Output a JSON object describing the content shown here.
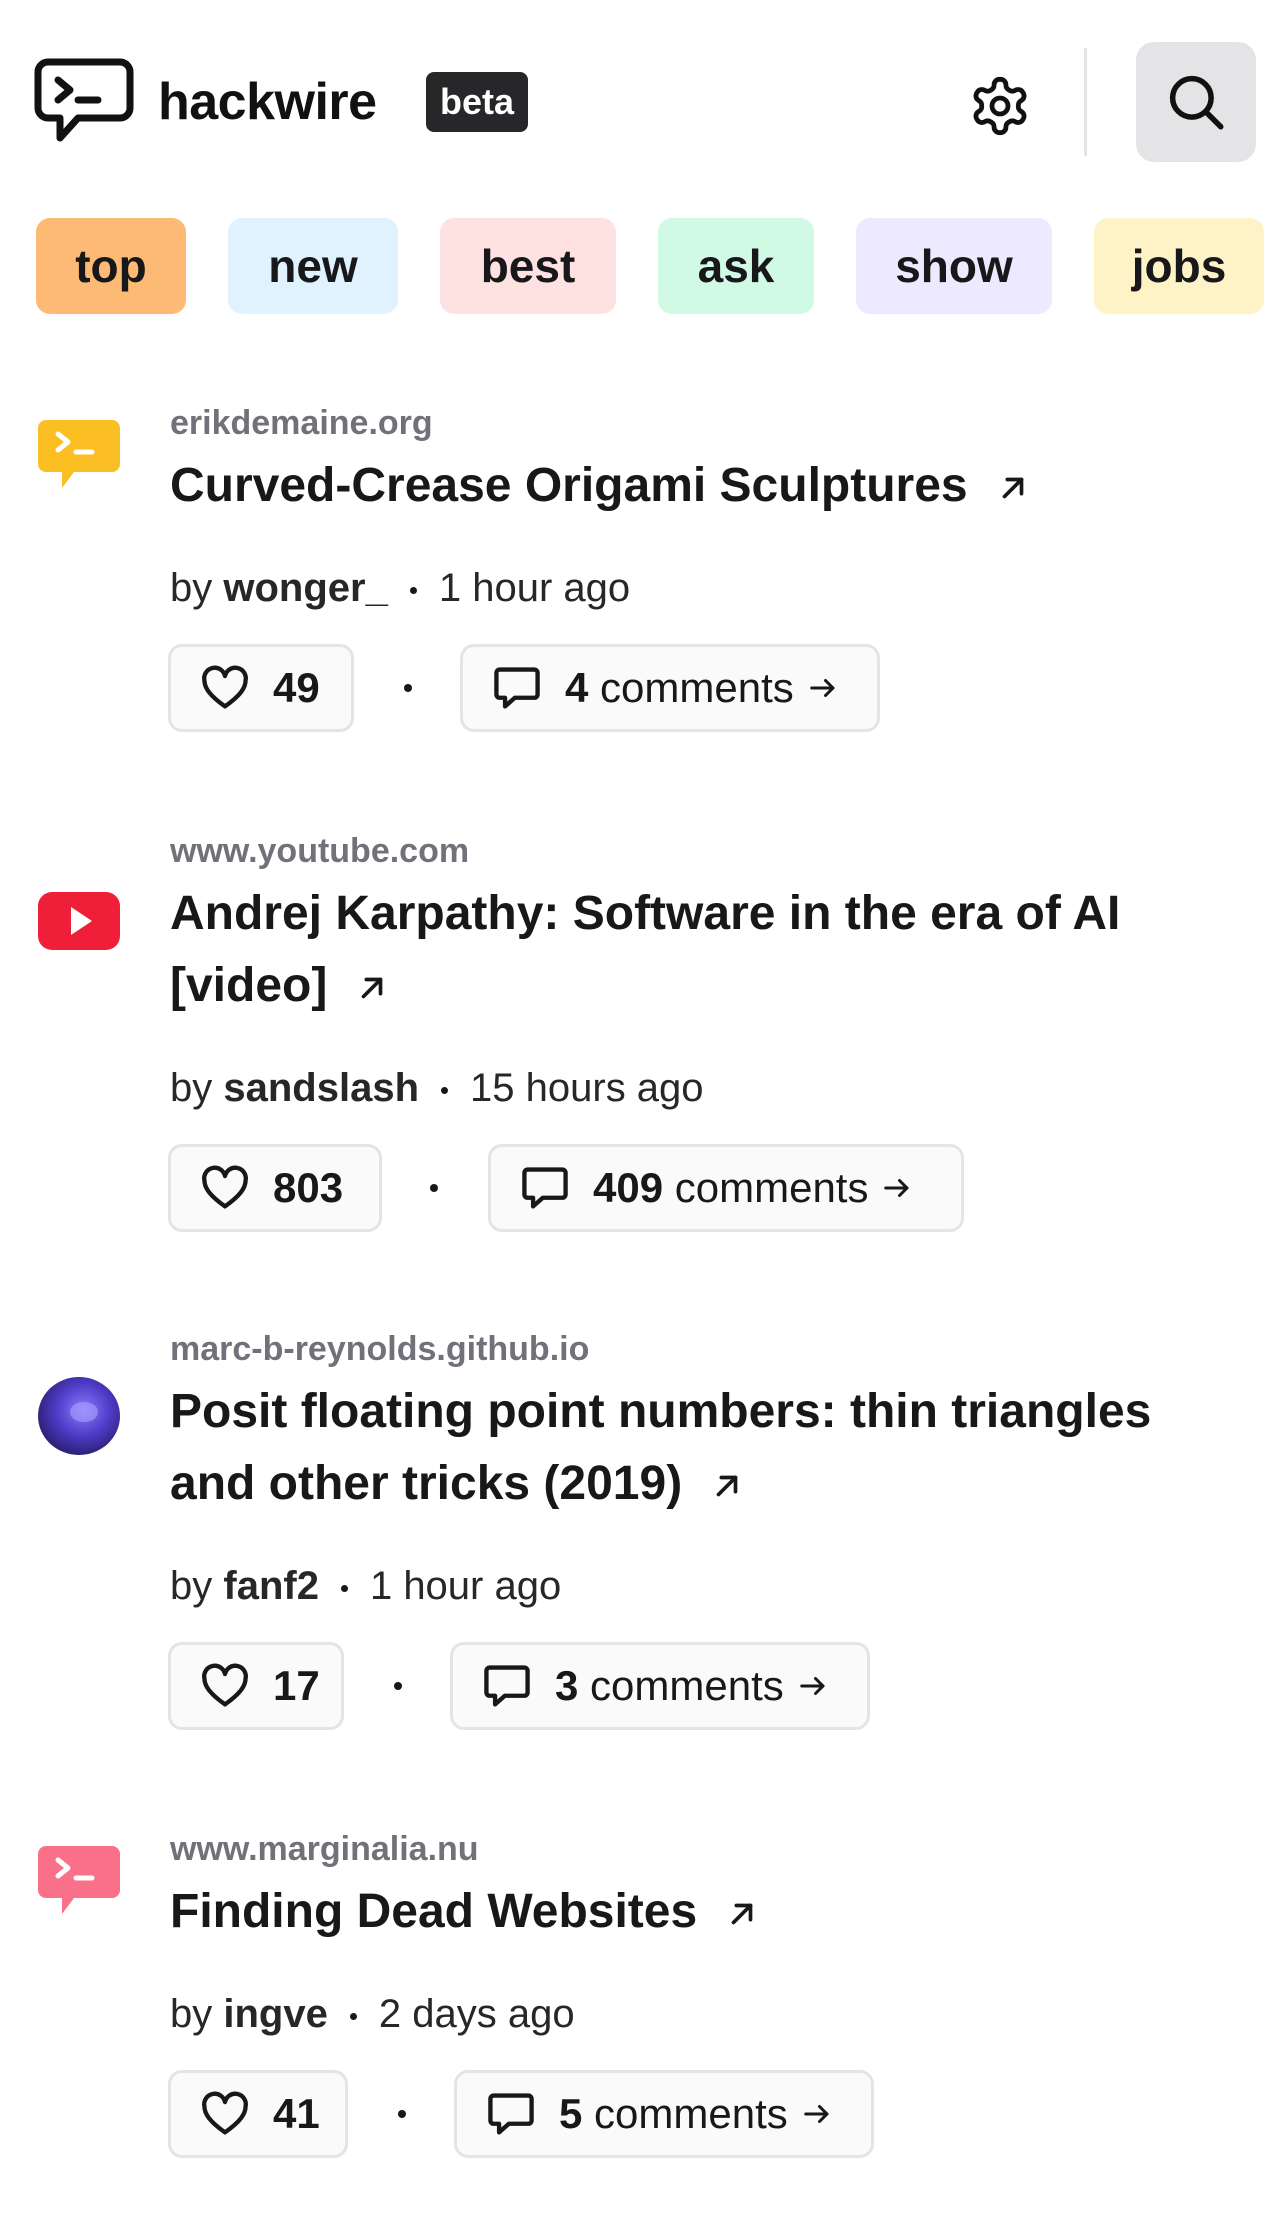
{
  "app": {
    "title": "hackwire",
    "badge": "beta"
  },
  "tabs": [
    {
      "label": "top",
      "bg": "#fdba74"
    },
    {
      "label": "new",
      "bg": "#e0f2fe"
    },
    {
      "label": "best",
      "bg": "#fee2e2"
    },
    {
      "label": "ask",
      "bg": "#d1fae5"
    },
    {
      "label": "show",
      "bg": "#ede9fe"
    },
    {
      "label": "jobs",
      "bg": "#fef3c7"
    }
  ],
  "stories": [
    {
      "icon": "terminal-chat-icon",
      "icon_color": "#fbbf24",
      "domain": "erikdemaine.org",
      "title": "Curved-Crease Origami Sculptures",
      "by": "by",
      "author": "wonger_",
      "time": "1 hour ago",
      "points": "49",
      "comments_count": "4",
      "comments_word": "comments"
    },
    {
      "icon": "youtube-icon",
      "icon_color": "#ef1f3a",
      "domain": "www.youtube.com",
      "title": "Andrej Karpathy: Software in the era of AI [video]",
      "by": "by",
      "author": "sandslash",
      "time": "15 hours ago",
      "points": "803",
      "comments_count": "409",
      "comments_word": "comments"
    },
    {
      "icon": "sphere-favicon-icon",
      "icon_color": "#5b3fd6",
      "domain": "marc-b-reynolds.github.io",
      "title": "Posit floating point numbers: thin triangles and other tricks (2019)",
      "by": "by",
      "author": "fanf2",
      "time": "1 hour ago",
      "points": "17",
      "comments_count": "3",
      "comments_word": "comments"
    },
    {
      "icon": "terminal-chat-icon",
      "icon_color": "#f87188",
      "domain": "www.marginalia.nu",
      "title": "Finding Dead Websites",
      "by": "by",
      "author": "ingve",
      "time": "2 days ago",
      "points": "41",
      "comments_count": "5",
      "comments_word": "comments"
    }
  ]
}
